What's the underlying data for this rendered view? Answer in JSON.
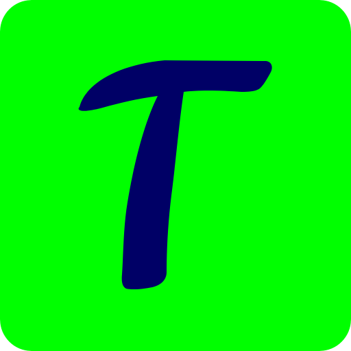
{
  "icon": {
    "name": "T app icon",
    "letter": "T",
    "colors": {
      "background": "#00ff00",
      "glyph": "#000066"
    }
  }
}
